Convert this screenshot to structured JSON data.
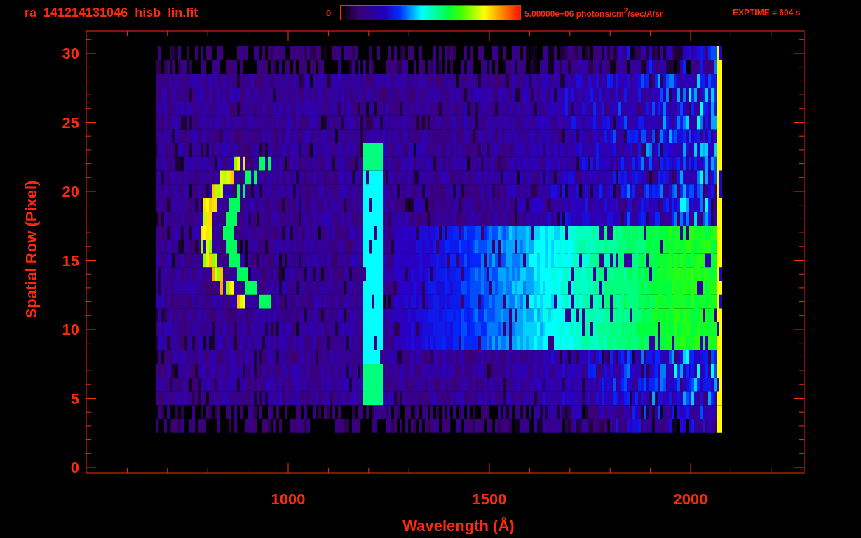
{
  "title": "ra_141214131046_hisb_lin.fit",
  "colorbar": {
    "min_label": "0",
    "max_label": "5.00000e+06 photons/cm$^{2}$/sec/A/sr"
  },
  "exptime": "EXPTIME = 604 s",
  "plot": {
    "xlabel": "Wavelength (Å)",
    "ylabel": "Spatial Row (Pixel)",
    "xtick_labels": [
      "1000",
      "1500",
      "2000"
    ],
    "ytick_labels": [
      "30",
      "25",
      "20",
      "15",
      "10",
      "5",
      "0"
    ]
  }
}
